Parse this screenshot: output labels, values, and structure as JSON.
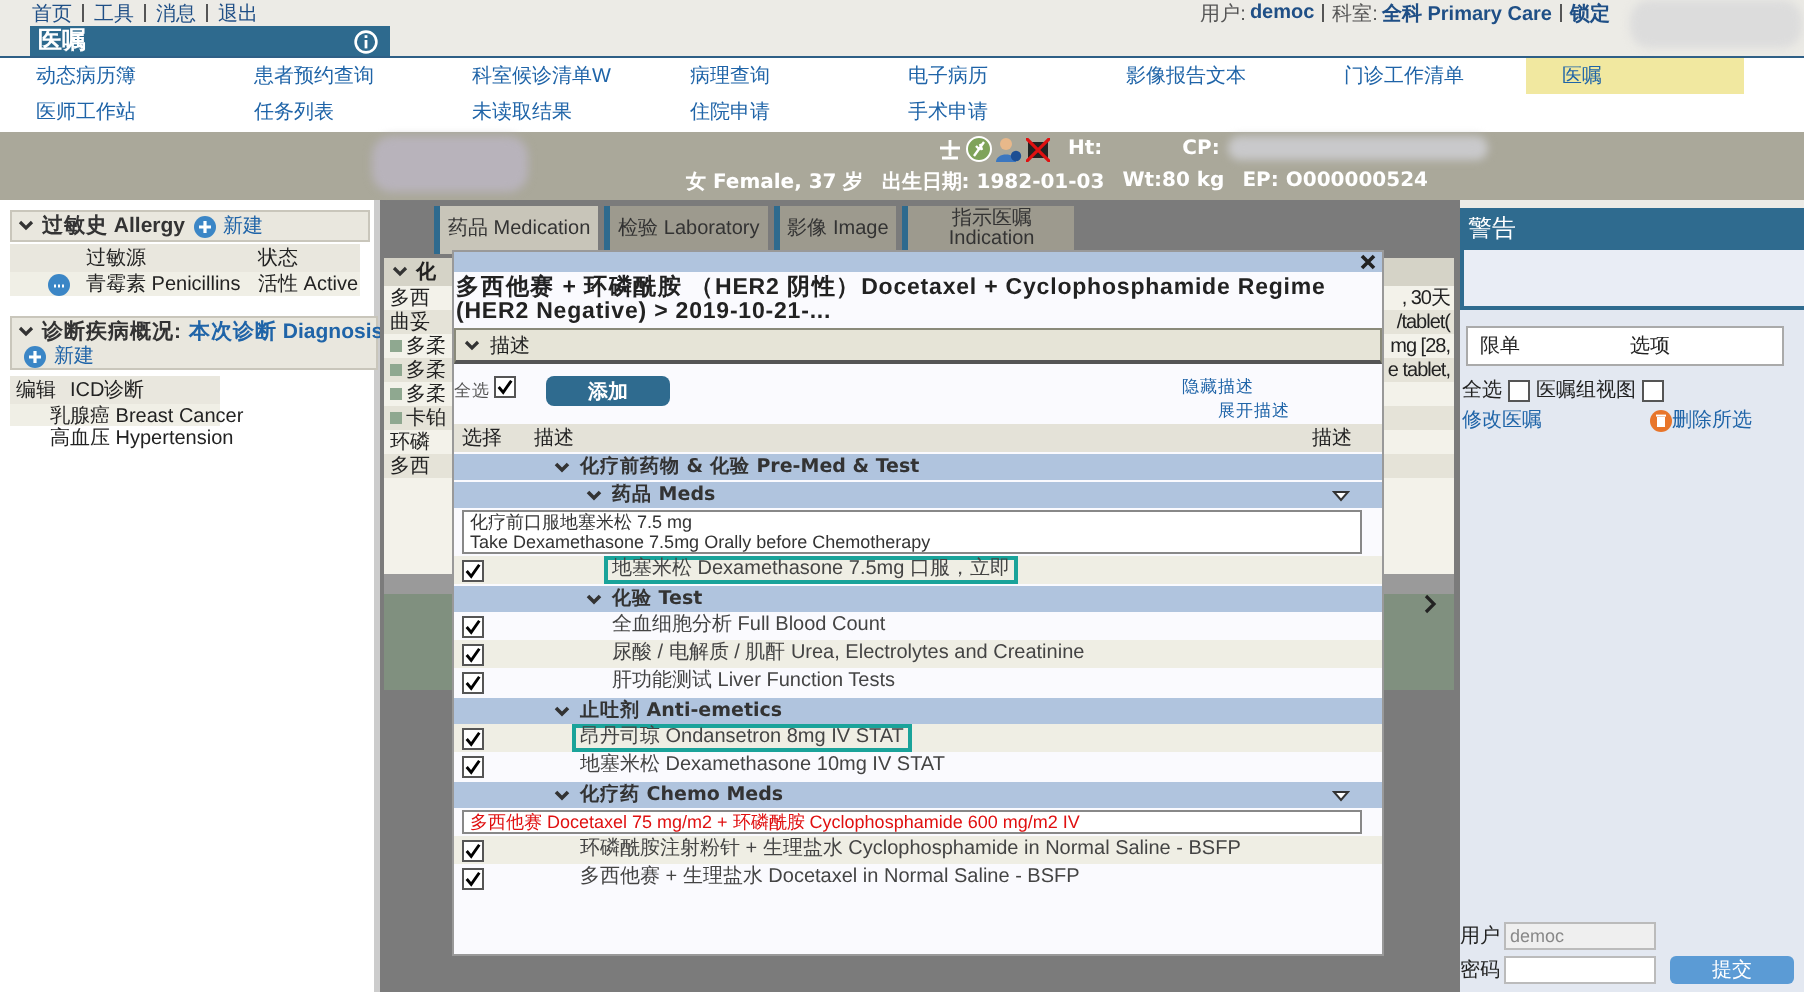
{
  "top_links": [
    "首页",
    "工具",
    "消息",
    "退出"
  ],
  "user_info": {
    "user_label": "用户:",
    "user": "democ",
    "dept_label": "科室:",
    "dept": "全科 Primary Care",
    "lock": "锁定"
  },
  "page_title": "医嘱",
  "nav": [
    {
      "label": "动态病历簿",
      "selected": false
    },
    {
      "label": "患者预约查询",
      "selected": false
    },
    {
      "label": "科室候诊清单W",
      "selected": false
    },
    {
      "label": "病理查询",
      "selected": false
    },
    {
      "label": "电子病历",
      "selected": false
    },
    {
      "label": "影像报告文本",
      "selected": false
    },
    {
      "label": "门诊工作清单",
      "selected": false
    },
    {
      "label": "医嘱",
      "selected": true
    },
    {
      "label": "医师工作站",
      "selected": false
    },
    {
      "label": "任务列表",
      "selected": false
    },
    {
      "label": "未读取结果",
      "selected": false
    },
    {
      "label": "住院申请",
      "selected": false
    },
    {
      "label": "手术申请",
      "selected": false
    }
  ],
  "patient": {
    "top": [
      "Ht:",
      "CP:"
    ],
    "details": [
      "女 Female, 37 岁",
      "出生日期: 1982-01-03",
      "Wt:80 kg",
      "EP: O000000524"
    ]
  },
  "allergy": {
    "title": "过敏史 Allergy",
    "new": "新建",
    "columns": [
      "过敏源",
      "状态"
    ],
    "rows": [
      {
        "name": "青霉素 Penicillins",
        "status": "活性 Active"
      }
    ]
  },
  "diagnosis": {
    "title": "诊断疾病概况:",
    "link": "本次诊断 Diagnosis",
    "new": "新建",
    "columns": [
      "编辑",
      "ICD诊断"
    ],
    "rows": [
      "乳腺癌 Breast Cancer",
      "高血压 Hypertension"
    ]
  },
  "tabs": [
    {
      "label": "药品 Medication",
      "selected": true
    },
    {
      "label": "检验 Laboratory",
      "selected": false
    },
    {
      "label": "影像 Image",
      "selected": false
    },
    {
      "label": "指示医嘱 Indication",
      "selected": false
    }
  ],
  "background_list": {
    "header": "化",
    "rows": [
      {
        "left": "多西",
        "right": ", 30天",
        "marker": false
      },
      {
        "left": "曲妥",
        "right": "/tablet(",
        "marker": false
      },
      {
        "left": "多柔",
        "right": "mg [28,",
        "marker": true
      },
      {
        "left": "多柔",
        "right": "e tablet,",
        "marker": true
      },
      {
        "left": "多柔",
        "marker": true
      },
      {
        "left": "卡铂",
        "marker": true
      },
      {
        "left": "环磷",
        "marker": false
      },
      {
        "left": "多西",
        "marker": false
      }
    ]
  },
  "modal": {
    "title": "多西他赛 + 环磷酰胺 （HER2 阴性）Docetaxel + Cyclophosphamide Regime (HER2 Negative) > 2019-10-21-...",
    "section": "描述",
    "select_all": "全选",
    "select_all_checked": true,
    "add": "添加",
    "hide_desc": "隐藏描述",
    "show_desc": "展开描述",
    "columns": [
      "选择",
      "描述",
      "描述"
    ],
    "rows": [
      {
        "kind": "group",
        "label": "化疗前药物 & 化验 Pre-Med & Test",
        "expanded": true,
        "filter": false,
        "children": [
          {
            "kind": "group",
            "label": "药品 Meds",
            "expanded": true,
            "filter": true,
            "children": [
              {
                "kind": "note",
                "text": "化疗前口服地塞米松 7.5 mg\nTake Dexamethasone 7.5mg Orally before Chemotherapy",
                "alert": false
              },
              {
                "kind": "item",
                "label": "地塞米松 Dexamethasone 7.5mg 口服，立即",
                "checked": true,
                "highlighted": true
              }
            ]
          },
          {
            "kind": "group",
            "label": "化验 Test",
            "expanded": true,
            "filter": false,
            "children": [
              {
                "kind": "item",
                "label": "全血细胞分析 Full Blood Count",
                "checked": true,
                "highlighted": false
              },
              {
                "kind": "item",
                "label": "尿酸 / 电解质 / 肌酐 Urea, Electrolytes and Creatinine",
                "checked": true,
                "highlighted": false
              },
              {
                "kind": "item",
                "label": "肝功能测试 Liver Function Tests",
                "checked": true,
                "highlighted": false
              }
            ]
          }
        ]
      },
      {
        "kind": "group",
        "label": "止吐剂 Anti-emetics",
        "expanded": true,
        "filter": false,
        "children": [
          {
            "kind": "item",
            "label": "昂丹司琼 Ondansetron 8mg IV STAT",
            "checked": true,
            "highlighted": true
          },
          {
            "kind": "item",
            "label": "地塞米松 Dexamethasone 10mg IV STAT",
            "checked": true,
            "highlighted": false
          }
        ]
      },
      {
        "kind": "group",
        "label": "化疗药 Chemo Meds",
        "expanded": true,
        "filter": true,
        "children": [
          {
            "kind": "note",
            "text": "多西他赛 Docetaxel 75 mg/m2 + 环磷酰胺 Cyclophosphamide 600 mg/m2 IV",
            "alert": true
          },
          {
            "kind": "item",
            "label": "环磷酰胺注射粉针 + 生理盐水 Cyclophosphamide in Normal Saline - BSFP",
            "checked": true,
            "highlighted": false
          },
          {
            "kind": "item",
            "label": "多西他赛 + 生理盐水 Docetaxel in Normal Saline - BSFP",
            "checked": true,
            "highlighted": false
          }
        ]
      }
    ]
  },
  "alerts": {
    "title": "警告",
    "columns": [
      "限单",
      "选项"
    ],
    "select_all": "全选",
    "select_all_checked": false,
    "group_view": "医嘱组视图",
    "group_view_checked": false,
    "edit_link": "修改医嘱",
    "delete_link": "删除所选",
    "user_label": "用户",
    "user_value": "democ",
    "password_label": "密码",
    "submit": "提交"
  }
}
